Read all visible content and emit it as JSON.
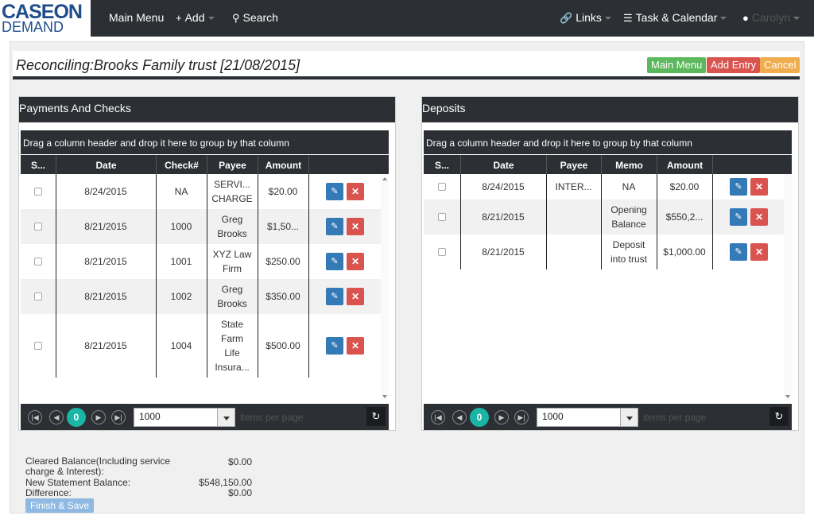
{
  "brand": {
    "line1": "CASEON",
    "line2": "DEMAND"
  },
  "nav": {
    "main_menu": "Main Menu",
    "add": "Add",
    "search": "Search",
    "links": "Links",
    "task_calendar": "Task & Calendar",
    "user_name": "Carolyn",
    "icons": {
      "add": "plus-icon",
      "search": "search-icon",
      "links": "link-icon",
      "calendar": "calendar-icon",
      "user": "user-icon"
    }
  },
  "header": {
    "title": "Reconciling:Brooks Family trust [21/08/2015]",
    "main_menu_btn": "Main Menu",
    "add_entry_btn": "Add Entry",
    "cancel_btn": "Cancel",
    "colors": {
      "green": "#5cb85c",
      "red": "#d9534f",
      "orange": "#f0ad4e"
    }
  },
  "payments": {
    "title": "Payments And Checks",
    "group_hint": "Drag a column header and drop it here to group by that column",
    "columns": [
      "S...",
      "Date",
      "Check#",
      "Payee",
      "Amount"
    ],
    "rows": [
      {
        "date": "8/24/2015",
        "check": "NA",
        "payee": "SERVI... CHARGE",
        "amount": "$20.00"
      },
      {
        "date": "8/21/2015",
        "check": "1000",
        "payee": "Greg Brooks",
        "amount": "$1,50..."
      },
      {
        "date": "8/21/2015",
        "check": "1001",
        "payee": "XYZ Law Firm",
        "amount": "$250.00"
      },
      {
        "date": "8/21/2015",
        "check": "1002",
        "payee": "Greg Brooks",
        "amount": "$350.00"
      },
      {
        "date": "8/21/2015",
        "check": "1004",
        "payee": "State Farm Life Insura...",
        "amount": "$500.00"
      }
    ],
    "pager": {
      "page": "0",
      "page_size": "1000",
      "info": "items per page"
    }
  },
  "deposits": {
    "title": "Deposits",
    "group_hint": "Drag a column header and drop it here to group by that column",
    "columns": [
      "S...",
      "Date",
      "Payee",
      "Memo",
      "Amount"
    ],
    "rows": [
      {
        "date": "8/24/2015",
        "payee": "INTER...",
        "memo": "NA",
        "amount": "$20.00"
      },
      {
        "date": "8/21/2015",
        "payee": "",
        "memo": "Opening Balance",
        "amount": "$550,2..."
      },
      {
        "date": "8/21/2015",
        "payee": "",
        "memo": "Deposit into trust",
        "amount": "$1,000.00"
      }
    ],
    "pager": {
      "page": "0",
      "page_size": "1000",
      "info": "items per page"
    }
  },
  "summary": {
    "cleared_label": "Cleared Balance(Including service charge & Interest):",
    "cleared_value": "$0.00",
    "new_statement_label": "New Statement Balance:",
    "new_statement_value": "$548,150.00",
    "difference_label": "Difference:",
    "difference_value": "$0.00",
    "finish_button": "Finish & Save"
  }
}
